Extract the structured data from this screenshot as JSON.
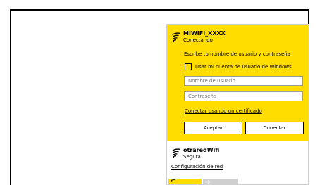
{
  "colors": {
    "accent": "#ffdd00",
    "panel_border": "#cfcfcf",
    "placeholder_text": "#8a8a8a",
    "tile_gray": "#cfcfcf"
  },
  "networks": {
    "selected": {
      "icon": "wifi-icon",
      "name": "MIWIFI_XXXX",
      "status": "Conectando",
      "prompt": "Escribe tu nombre de usuario y contraseña",
      "use_windows_account": {
        "label": "Usar mi cuenta de usuario de Windows",
        "checked": false
      },
      "username": {
        "value": "",
        "placeholder": "Nombre de usuario"
      },
      "password": {
        "value": "",
        "placeholder": "Contraseña"
      },
      "certificate_link": "Conectar usando un certificado",
      "accept_button": "Aceptar",
      "connect_button": "Conectar"
    },
    "other": {
      "icon": "wifi-icon",
      "name": "otraredWifi",
      "status": "Segura"
    }
  },
  "footer": {
    "network_settings_link": "Configuración de red",
    "quick_actions": [
      {
        "icon": "wifi-icon",
        "active": true
      },
      {
        "icon": "airplane-icon",
        "active": false
      }
    ]
  }
}
